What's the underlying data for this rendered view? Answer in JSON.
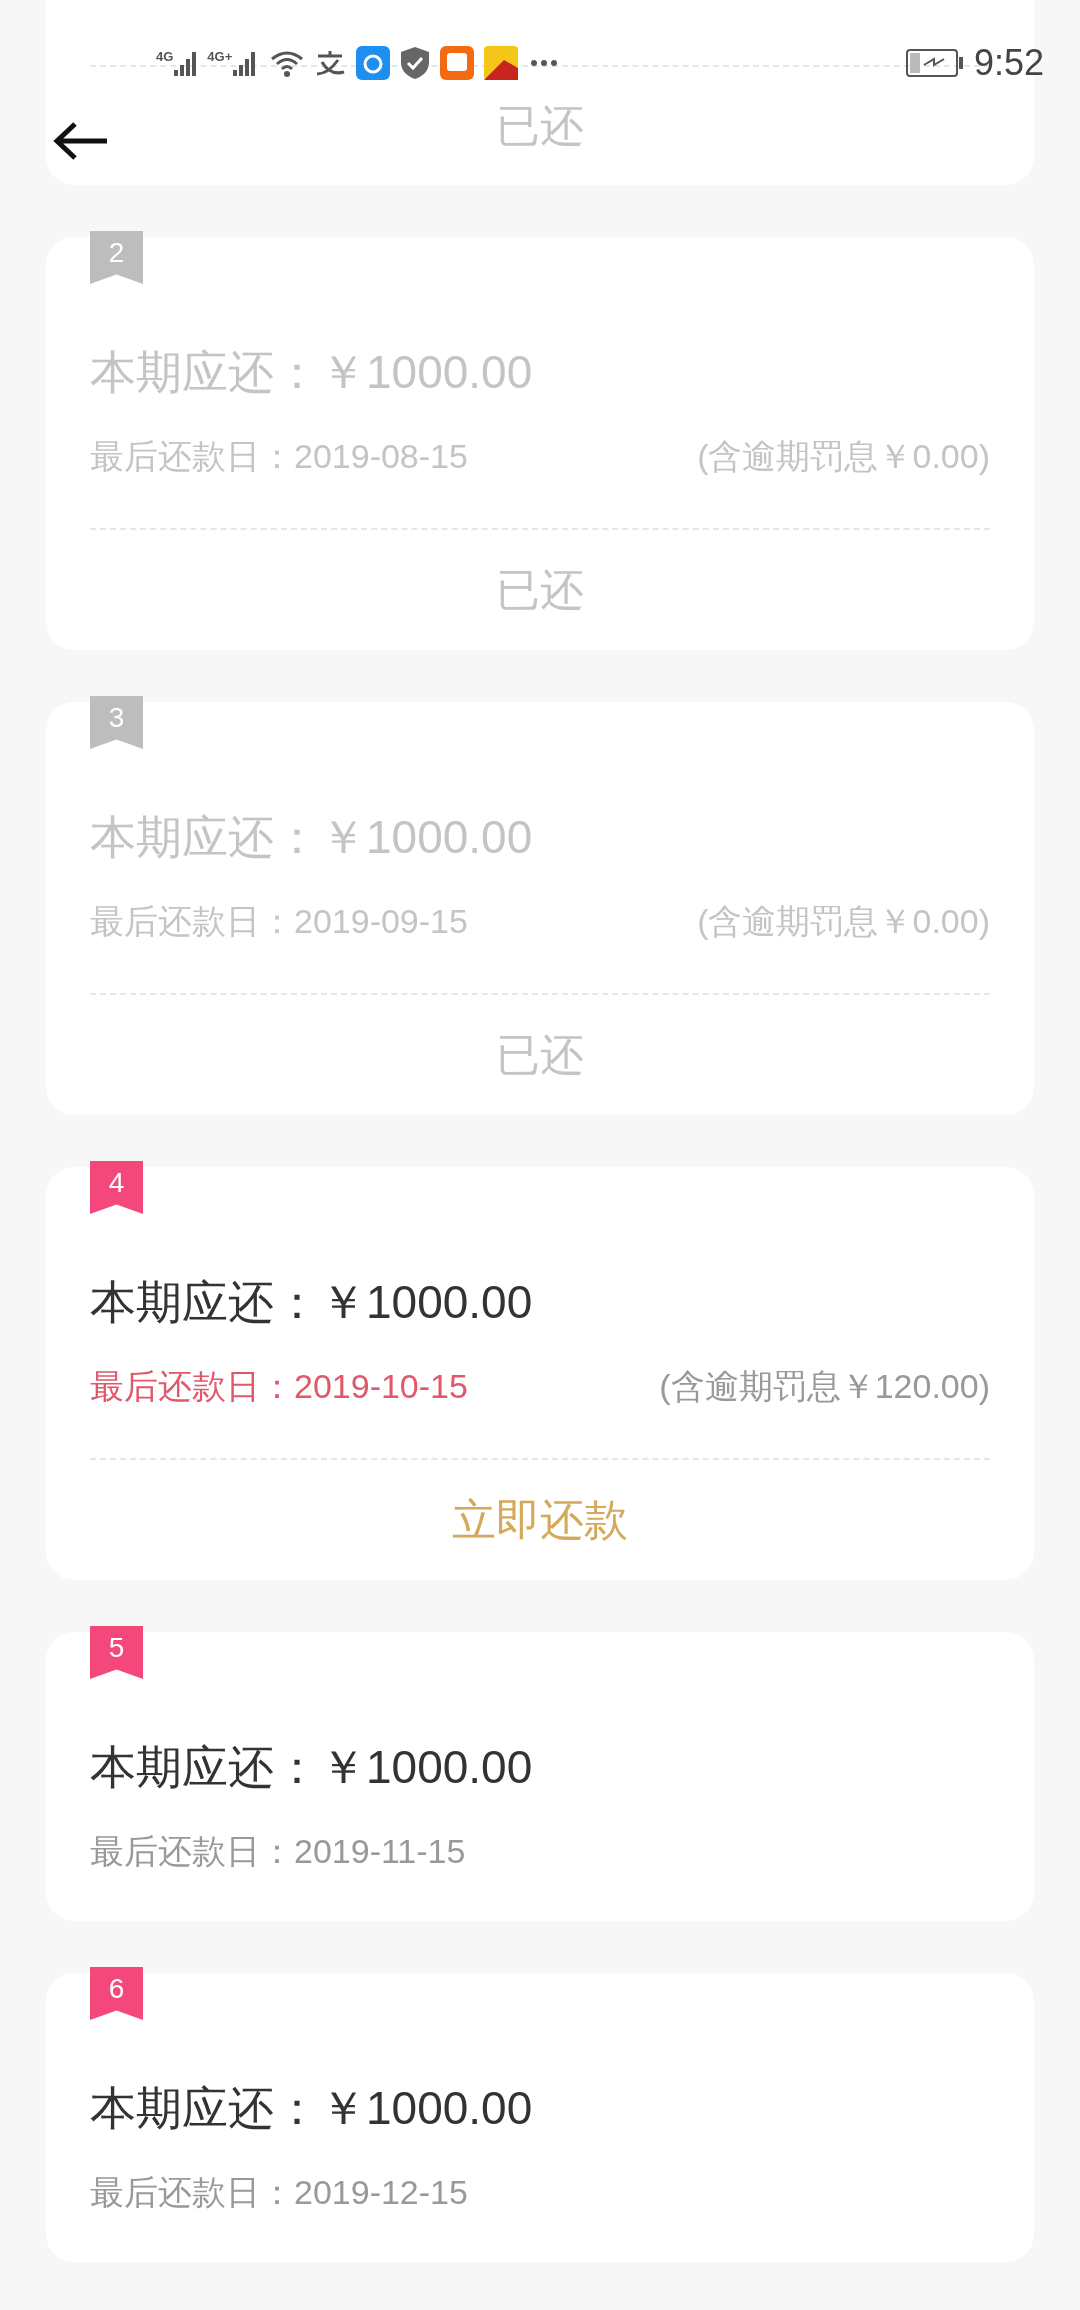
{
  "status_bar": {
    "networks": [
      "4G",
      "4G+"
    ],
    "time": "9:52"
  },
  "cards": [
    {
      "status": {
        "kind": "paid",
        "text": "已还"
      }
    },
    {
      "number": "2",
      "paid": true,
      "amount_label": "本期应还：",
      "amount": "￥1000.00",
      "due_label": "最后还款日：",
      "due_date": "2019-08-15",
      "penalty": "(含逾期罚息￥0.00)",
      "status": {
        "kind": "paid",
        "text": "已还"
      }
    },
    {
      "number": "3",
      "paid": true,
      "amount_label": "本期应还：",
      "amount": "￥1000.00",
      "due_label": "最后还款日：",
      "due_date": "2019-09-15",
      "penalty": "(含逾期罚息￥0.00)",
      "status": {
        "kind": "paid",
        "text": "已还"
      }
    },
    {
      "number": "4",
      "paid": false,
      "overdue": true,
      "amount_label": "本期应还：",
      "amount": "￥1000.00",
      "due_label": "最后还款日：",
      "due_date": "2019-10-15",
      "penalty": "(含逾期罚息￥120.00)",
      "status": {
        "kind": "pay",
        "text": "立即还款"
      }
    },
    {
      "number": "5",
      "paid": false,
      "overdue": false,
      "amount_label": "本期应还：",
      "amount": "￥1000.00",
      "due_label": "最后还款日：",
      "due_date": "2019-11-15"
    },
    {
      "number": "6",
      "paid": false,
      "overdue": false,
      "amount_label": "本期应还：",
      "amount": "￥1000.00",
      "due_label": "最后还款日：",
      "due_date": "2019-12-15"
    }
  ]
}
